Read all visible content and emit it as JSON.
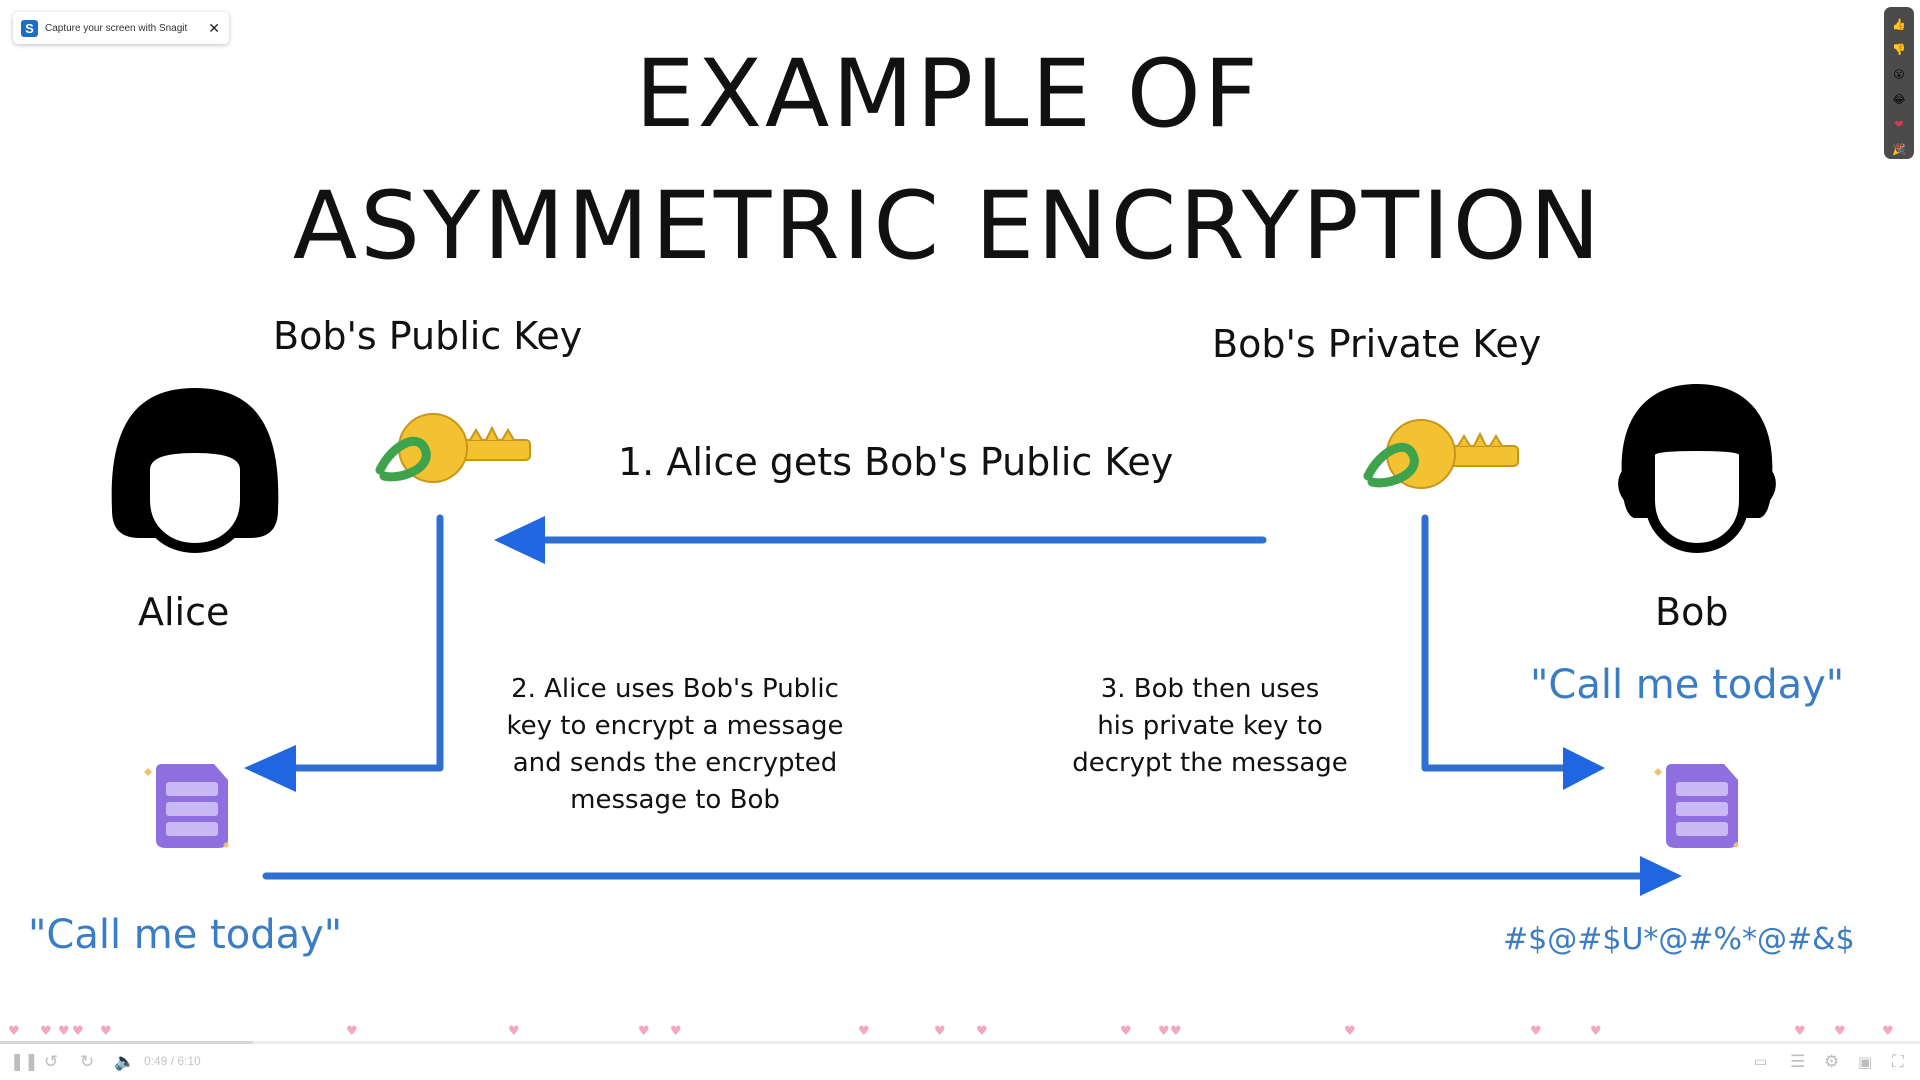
{
  "snagit": {
    "logo": "S",
    "message": "Capture your screen with Snagit",
    "close": "✕"
  },
  "reactions": [
    "👍",
    "👎",
    "😮",
    "😂",
    "❤",
    "🎉"
  ],
  "slide": {
    "title_line1": "EXAMPLE OF",
    "title_line2": "ASYMMETRIC ENCRYPTION",
    "public_key_label": "Bob's Public Key",
    "private_key_label": "Bob's Private Key",
    "alice_label": "Alice",
    "bob_label": "Bob",
    "step1": "1. Alice gets Bob's Public Key",
    "step2": [
      "2. Alice uses Bob's Public",
      "key to encrypt a message",
      "and sends the encrypted",
      "message to Bob"
    ],
    "step3": [
      "3. Bob then uses",
      "his private key to",
      "decrypt the message"
    ],
    "alice_message": "\"Call me today\"",
    "bob_message": "\"Call me today\"",
    "cipher_text": "#$@#$U*@#%*@#&$",
    "colors": {
      "arrow": "#2f6fd0",
      "quote": "#3b7dc4",
      "key_gold": "#f2c232",
      "key_ring": "#3fa34d",
      "document": "#8f6fe0"
    },
    "icons": [
      "alice-avatar-icon",
      "bob-avatar-icon",
      "public-key-icon",
      "private-key-icon",
      "alice-document-icon",
      "bob-document-icon"
    ]
  },
  "player": {
    "time": "0:49 / 6:10",
    "progress": 0.132,
    "controls": [
      "pause-icon",
      "rewind-icon",
      "forward-icon",
      "volume-icon",
      "captions-icon",
      "chapters-icon",
      "settings-icon",
      "pip-icon",
      "fullscreen-icon"
    ]
  }
}
